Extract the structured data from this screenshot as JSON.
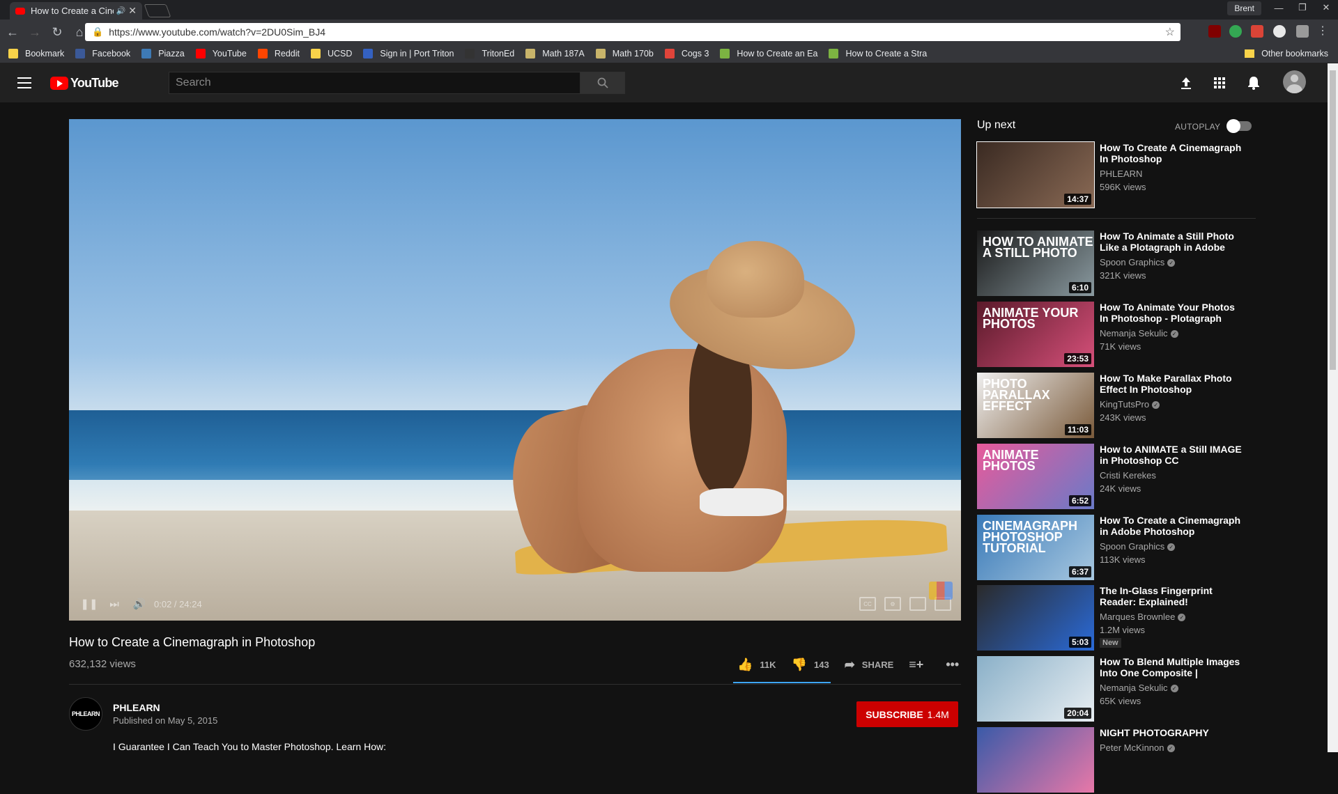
{
  "browser": {
    "tab_title": "How to Create a Cine",
    "profile_name": "Brent",
    "url": "https://www.youtube.com/watch?v=2DU0Sim_BJ4",
    "bookmarks": [
      {
        "label": "Bookmark",
        "color": "#f9d34a"
      },
      {
        "label": "Facebook",
        "color": "#3b5998"
      },
      {
        "label": "Piazza",
        "color": "#3e7ab5"
      },
      {
        "label": "YouTube",
        "color": "#ff0000"
      },
      {
        "label": "Reddit",
        "color": "#ff4500"
      },
      {
        "label": "UCSD",
        "color": "#f9d34a"
      },
      {
        "label": "Sign in | Port Triton",
        "color": "#3461c1"
      },
      {
        "label": "TritonEd",
        "color": "#333333"
      },
      {
        "label": "Math 187A",
        "color": "#c8b46a"
      },
      {
        "label": "Math 170b",
        "color": "#c8b46a"
      },
      {
        "label": "Cogs 3",
        "color": "#e0443a"
      },
      {
        "label": "How to Create an Ea",
        "color": "#7cb342"
      },
      {
        "label": "How to Create a Stra",
        "color": "#7cb342"
      }
    ],
    "other_bookmarks": "Other bookmarks"
  },
  "header": {
    "logo_text": "YouTube",
    "search_placeholder": "Search"
  },
  "video": {
    "title": "How to Create a Cinemagraph in Photoshop",
    "views": "632,132 views",
    "time": "0:02 / 24:24",
    "likes": "11K",
    "dislikes": "143",
    "share_label": "SHARE",
    "like_ratio": 0.987
  },
  "channel": {
    "name": "PHLEARN",
    "avatar_text": "PHLEARN",
    "published": "Published on May 5, 2015",
    "subscribe_label": "SUBSCRIBE",
    "subscriber_count": "1.4M",
    "description": "I Guarantee I Can Teach You to Master Photoshop. Learn How:"
  },
  "sidebar": {
    "up_next": "Up next",
    "autoplay": "AUTOPLAY",
    "items": [
      {
        "title": "How To Create A Cinemagraph In Photoshop",
        "channel": "PHLEARN",
        "views": "596K views",
        "duration": "14:37",
        "thumb_text": "",
        "colors": [
          "#3a2a22",
          "#8a6a55"
        ]
      },
      {
        "title": "How To Animate a Still Photo Like a Plotagraph in Adobe",
        "channel": "Spoon Graphics",
        "views": "321K views",
        "duration": "6:10",
        "thumb_text": "HOW TO ANIMATE A STILL PHOTO",
        "colors": [
          "#1a1a1a",
          "#8a9aa0"
        ]
      },
      {
        "title": "How To Animate Your Photos In Photoshop - Plotagraph Effect",
        "channel": "Nemanja Sekulic",
        "views": "71K views",
        "duration": "23:53",
        "thumb_text": "ANIMATE YOUR PHOTOS",
        "colors": [
          "#5a1a2a",
          "#d6507a"
        ]
      },
      {
        "title": "How To Make Parallax Photo Effect In Photoshop",
        "channel": "KingTutsPro",
        "views": "243K views",
        "duration": "11:03",
        "thumb_text": "PHOTO PARALLAX EFFECT",
        "colors": [
          "#f0f0f0",
          "#7a5a3a"
        ]
      },
      {
        "title": "How to ANIMATE a Still IMAGE in Photoshop CC",
        "channel": "Cristi Kerekes",
        "views": "24K views",
        "duration": "6:52",
        "thumb_text": "ANIMATE PHOTOS",
        "colors": [
          "#e85a9a",
          "#6a7ac8"
        ]
      },
      {
        "title": "How To Create a Cinemagraph in Adobe Photoshop",
        "channel": "Spoon Graphics",
        "views": "113K views",
        "duration": "6:37",
        "thumb_text": "CINEMAGRAPH PHOTOSHOP TUTORIAL",
        "colors": [
          "#3a7ab8",
          "#a8c8e0"
        ]
      },
      {
        "title": "The In-Glass Fingerprint Reader: Explained!",
        "channel": "Marques Brownlee",
        "views": "1.2M views",
        "duration": "5:03",
        "thumb_text": "",
        "badge": "New",
        "colors": [
          "#2a2a2a",
          "#2a6ad8"
        ]
      },
      {
        "title": "How To Blend Multiple Images Into One Composite |",
        "channel": "Nemanja Sekulic",
        "views": "65K views",
        "duration": "20:04",
        "thumb_text": "",
        "colors": [
          "#8ab0c8",
          "#e8eef2"
        ]
      },
      {
        "title": "NIGHT PHOTOGRAPHY",
        "channel": "Peter McKinnon",
        "views": "",
        "duration": "",
        "thumb_text": "",
        "colors": [
          "#3a5aa8",
          "#e878a8"
        ]
      }
    ]
  }
}
